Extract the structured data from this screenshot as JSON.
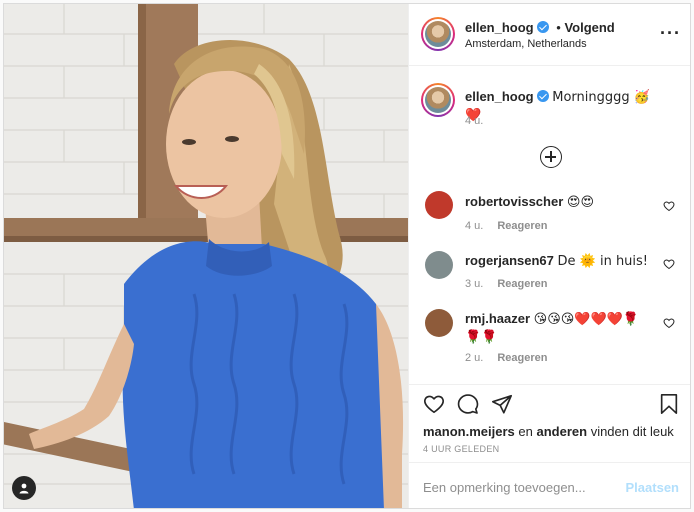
{
  "post": {
    "username": "ellen_hoog",
    "follow_separator": "•",
    "follow_label": "Volgend",
    "location": "Amsterdam, Netherlands",
    "more_icon": "more-horizontal-icon"
  },
  "caption": {
    "username": "ellen_hoog",
    "text": "Morningggg 🥳❤️",
    "time": "4 u."
  },
  "comments": [
    {
      "username": "robertovisscher",
      "text": "😍😍",
      "time": "4 u.",
      "reply_label": "Reageren",
      "avatar_color": "#c0392b"
    },
    {
      "username": "rogerjansen67",
      "text": "De 🌞 in huis!",
      "time": "3 u.",
      "reply_label": "Reageren",
      "avatar_color": "#7f8c8d"
    },
    {
      "username": "rmj.haazer",
      "text": "😘😘😘❤️❤️❤️🌹🌹🌹",
      "time": "2 u.",
      "reply_label": "Reageren",
      "avatar_color": "#8e5b3a"
    }
  ],
  "likes": {
    "user": "manon.meijers",
    "joiner": "en",
    "others": "anderen",
    "suffix": "vinden dit leuk",
    "timestamp": "4 UUR GELEDEN"
  },
  "composer": {
    "placeholder": "Een opmerking toevoegen...",
    "post_label": "Plaatsen"
  },
  "colors": {
    "accent": "#3897f0",
    "post_button_disabled": "#b2dffc",
    "sweater": "#3a6fd0"
  }
}
